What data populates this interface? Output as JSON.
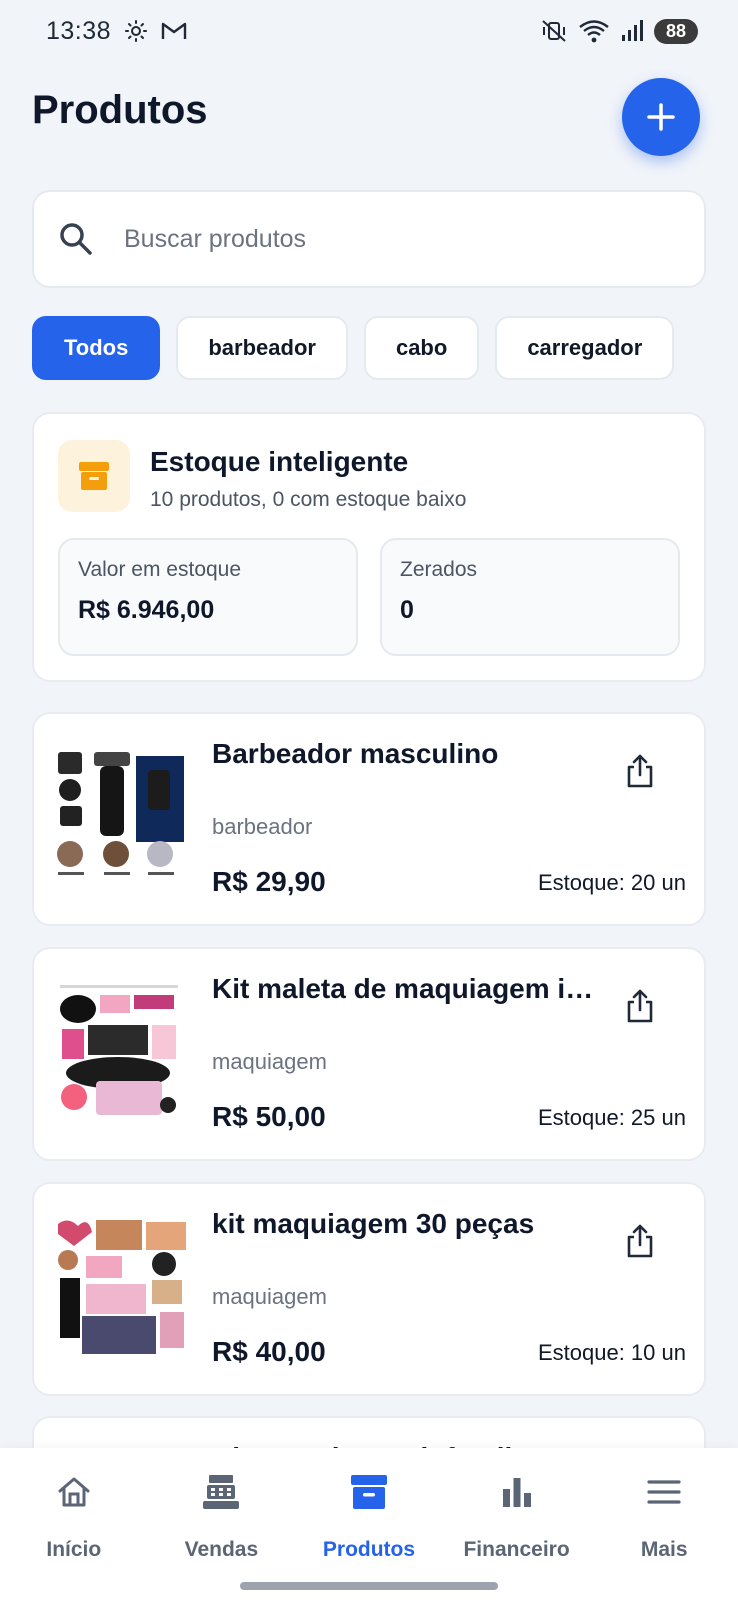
{
  "status_bar": {
    "time": "13:38",
    "battery": "88"
  },
  "header": {
    "title": "Produtos"
  },
  "search": {
    "placeholder": "Buscar produtos"
  },
  "chips": [
    {
      "label": "Todos",
      "active": true
    },
    {
      "label": "barbeador",
      "active": false
    },
    {
      "label": "cabo",
      "active": false
    },
    {
      "label": "carregador",
      "active": false
    }
  ],
  "smart_stock": {
    "title": "Estoque inteligente",
    "subtitle": "10 produtos, 0 com estoque baixo",
    "stats": [
      {
        "label": "Valor em estoque",
        "value": "R$ 6.946,00"
      },
      {
        "label": "Zerados",
        "value": "0"
      }
    ]
  },
  "products": [
    {
      "name": "Barbeador masculino",
      "category": "barbeador",
      "price": "R$ 29,90",
      "stock": "Estoque: 20 un",
      "image_icon": "shaver-product-image"
    },
    {
      "name": "Kit maleta de maquiagem infantil",
      "category": "maquiagem",
      "price": "R$ 50,00",
      "stock": "Estoque: 25 un",
      "image_icon": "makeup-case-product-image"
    },
    {
      "name": "kit maquiagem 30 peças",
      "category": "maquiagem",
      "price": "R$ 40,00",
      "stock": "Estoque: 10 un",
      "image_icon": "makeup-kit-product-image"
    }
  ],
  "partial_product": {
    "name": "Kit maquiagem infantil"
  },
  "bottom_nav": [
    {
      "label": "Início",
      "icon": "home-icon",
      "active": false
    },
    {
      "label": "Vendas",
      "icon": "cash-register-icon",
      "active": false
    },
    {
      "label": "Produtos",
      "icon": "archive-box-icon",
      "active": true
    },
    {
      "label": "Financeiro",
      "icon": "bar-chart-icon",
      "active": false
    },
    {
      "label": "Mais",
      "icon": "menu-icon",
      "active": false
    }
  ],
  "colors": {
    "accent": "#2563eb",
    "background": "#f1f4f9",
    "stock_icon": "#f59e0b"
  }
}
